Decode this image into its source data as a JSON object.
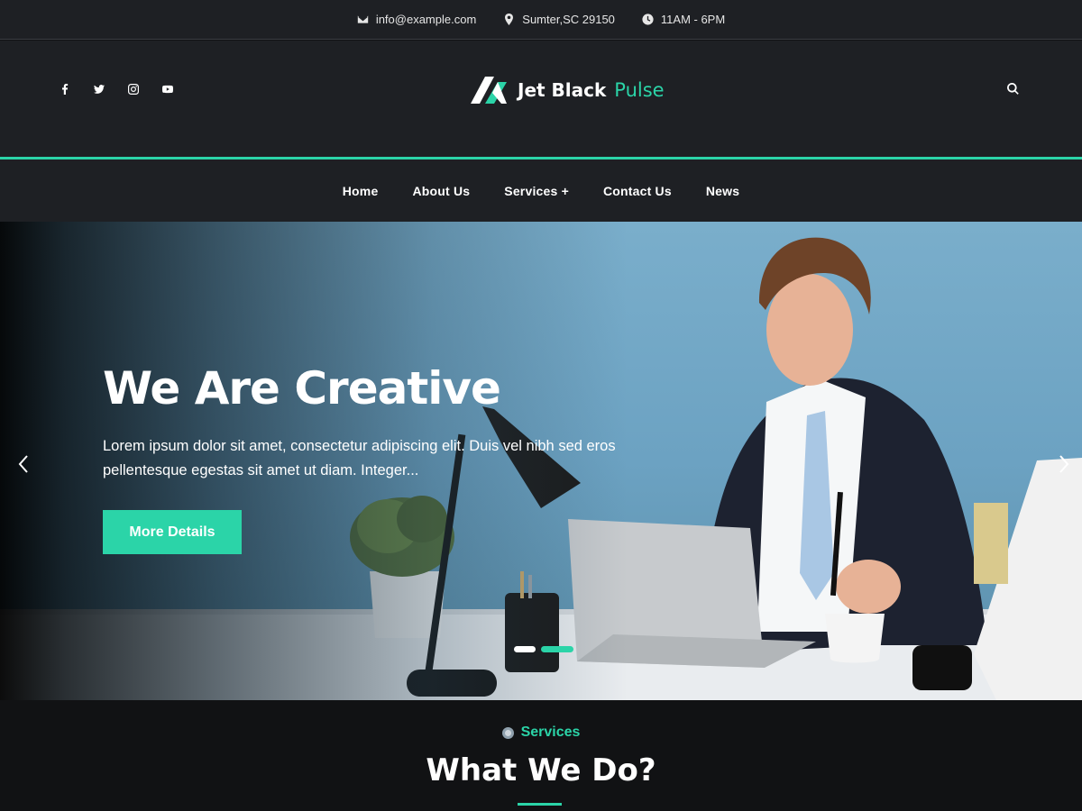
{
  "topbar": {
    "email": "info@example.com",
    "address": "Sumter,SC 29150",
    "hours": "11AM - 6PM"
  },
  "header": {
    "social_icons": [
      "facebook-icon",
      "twitter-icon",
      "instagram-icon",
      "youtube-icon"
    ],
    "logo": {
      "part1": "Jet Black",
      "part2": "Pulse"
    },
    "search_icon": "search-icon"
  },
  "nav": {
    "items": [
      "Home",
      "About Us",
      "Services +",
      "Contact Us",
      "News"
    ]
  },
  "hero": {
    "title": "We Are Creative",
    "text": "Lorem ipsum dolor sit amet, consectetur adipiscing elit. Duis vel nibh sed eros pellentesque egestas sit amet ut diam. Integer...",
    "button": "More Details",
    "slides_total": 2,
    "active_slide": 2
  },
  "services": {
    "tag": "Services",
    "title": "What We Do?"
  },
  "colors": {
    "accent": "#2bd4a8",
    "header_bg": "#1e2024",
    "page_bg": "#111214"
  }
}
